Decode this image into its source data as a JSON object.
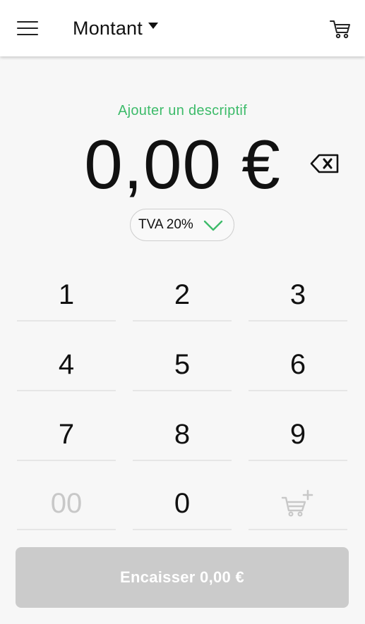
{
  "header": {
    "title": "Montant",
    "menu_icon": "hamburger-icon",
    "cart_icon": "cart-icon"
  },
  "amount": {
    "add_description_link": "Ajouter un descriptif",
    "value": "0,00 €",
    "backspace_icon": "backspace-icon"
  },
  "tax": {
    "selected": "TVA 20%",
    "chevron_icon": "chevron-down-icon"
  },
  "keypad": {
    "keys": [
      "1",
      "2",
      "3",
      "4",
      "5",
      "6",
      "7",
      "8",
      "9",
      "00",
      "0"
    ],
    "add_to_cart_icon": "cart-plus-icon"
  },
  "checkout": {
    "label": "Encaisser 0,00 €"
  },
  "colors": {
    "accent_green": "#3dbb6a",
    "disabled_gray": "#cbcbcb",
    "background": "#f7f7f7"
  }
}
